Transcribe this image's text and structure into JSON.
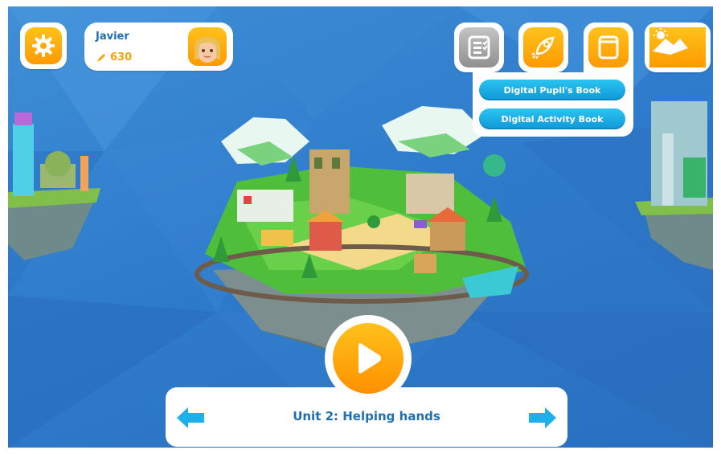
{
  "player": {
    "name": "Javier",
    "score": "630"
  },
  "menu": {
    "books": [
      {
        "label": "Digital Pupil's Book"
      },
      {
        "label": "Digital Activity Book"
      }
    ]
  },
  "unit": {
    "title": "Unit 2: Helping hands"
  },
  "icons": {
    "settings": "gear-icon",
    "checklist": "checklist-icon",
    "rocket": "rocket-icon",
    "book": "book-icon",
    "weather": "sun-mountain-icon",
    "play": "play-icon",
    "prev": "arrow-left-icon",
    "next": "arrow-right-icon",
    "score": "pencil-icon"
  },
  "colors": {
    "accent_orange": "#ff9a00",
    "accent_blue": "#1f6fb4",
    "menu_button": "#16a9e4",
    "arrow": "#1fb0ea",
    "background": "#2f7ccc"
  }
}
